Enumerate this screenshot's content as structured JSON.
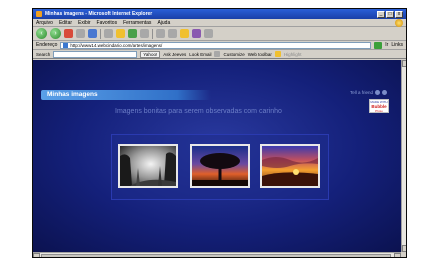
{
  "window": {
    "title": "Minhas imagens - Microsoft Internet Explorer",
    "min": "_",
    "max": "□",
    "close": "x"
  },
  "menu": [
    "Arquivo",
    "Editar",
    "Exibir",
    "Favoritos",
    "Ferramentas",
    "Ajuda"
  ],
  "address": {
    "label": "Endereço",
    "url": "http://www14.webcindario.com/artes/imagens/",
    "go": "Ir",
    "links": "Links"
  },
  "search": {
    "label": "Search",
    "yahoo": "Yahoo!",
    "ask": "Ask Jeeves",
    "email": "Look Email",
    "custom": "Customize",
    "custom2": "Web toolbar",
    "highlight": "Highlight"
  },
  "page": {
    "heading": "Minhas imagens",
    "tell_friend": "Tell a friend",
    "subtitle": "Imagens bonitas para serem observadas com carinho",
    "badge_top": "MADE WITH",
    "badge_main": "Bubble",
    "badge_sub": "Photo"
  },
  "images": [
    {
      "name": "foggy-forest"
    },
    {
      "name": "tree-sunset"
    },
    {
      "name": "sunset-clouds"
    }
  ]
}
